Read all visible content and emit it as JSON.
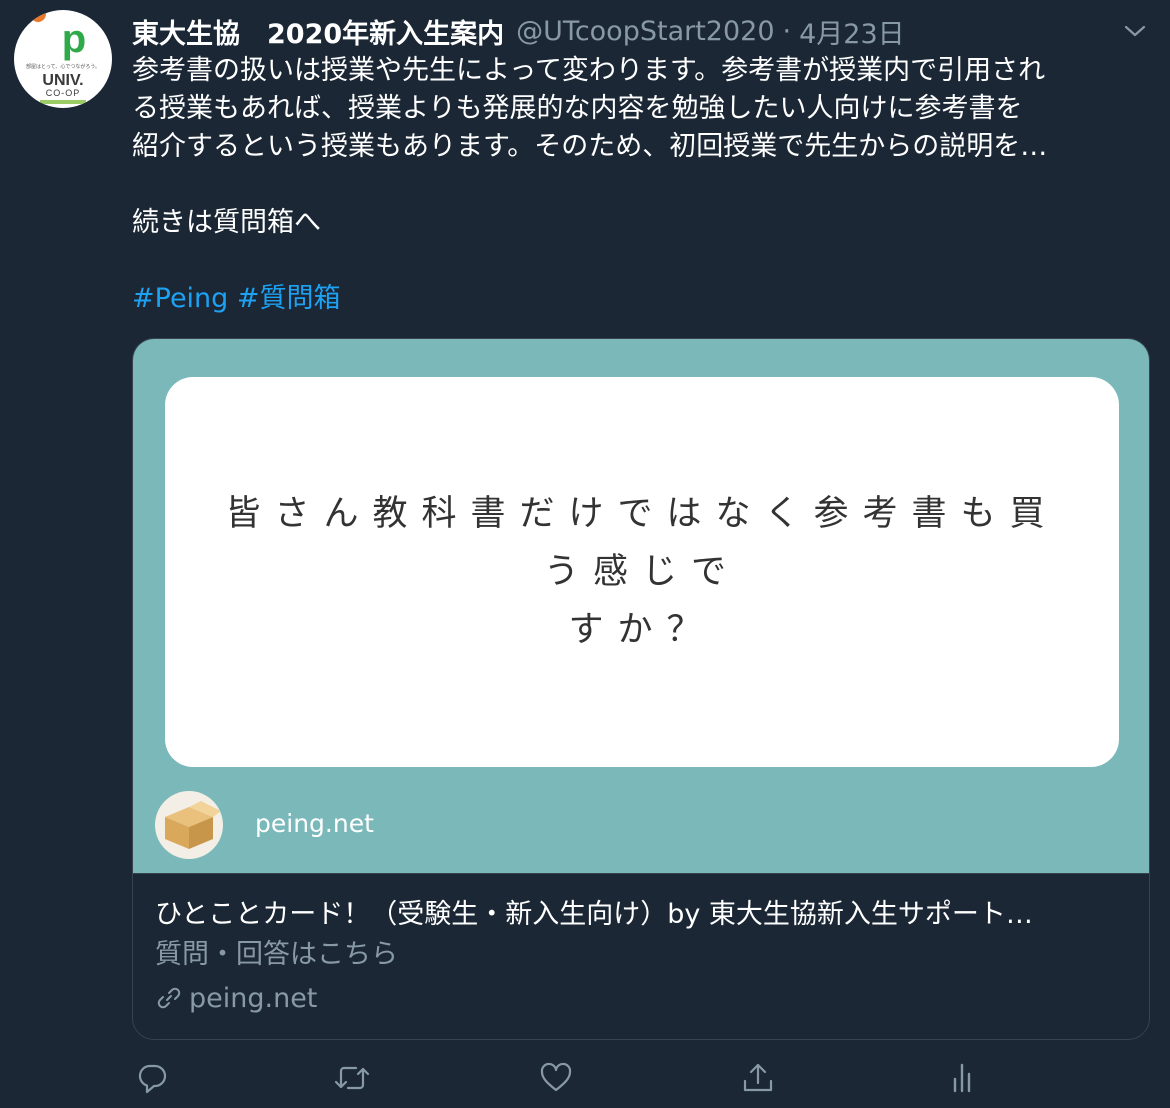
{
  "tweet": {
    "display_name": "東大生協　2020年新入生案内",
    "handle": "@UTcoopStart2020",
    "separator": "·",
    "date": "4月23日",
    "body_lines": [
      "参考書の扱いは授業や先生によって変わります。参考書が授業内で引用され",
      "る授業もあれば、授業よりも発展的な内容を勉強したい人向けに参考書を",
      "紹介するという授業もあります。そのため、初回授業で先生からの説明を…"
    ],
    "continuation": "続きは質問箱へ",
    "hashtags": [
      "#Peing",
      "#質問箱"
    ]
  },
  "avatar": {
    "logo_letter": "p",
    "tagline": "部屋はとって、心でつながろう。",
    "brand": "UNIV.",
    "sub": "CO-OP"
  },
  "card": {
    "question_line1": "皆さん教科書だけではなく参考書も買う感じで",
    "question_line2": "すか？",
    "image_domain": "peing.net",
    "title": "ひとことカード！（受験生・新入生向け）by 東大生協新入生サポート…",
    "description": "質問・回答はこちら",
    "link_domain": "peing.net"
  },
  "actions": {
    "icons": [
      "reply-icon",
      "retweet-icon",
      "like-icon",
      "share-icon",
      "analytics-icon"
    ]
  },
  "colors": {
    "background": "#1b2735",
    "accent": "#1da1f2",
    "muted": "#8899a6",
    "card_image_bg": "#7ab8ba",
    "border": "#38444d"
  }
}
